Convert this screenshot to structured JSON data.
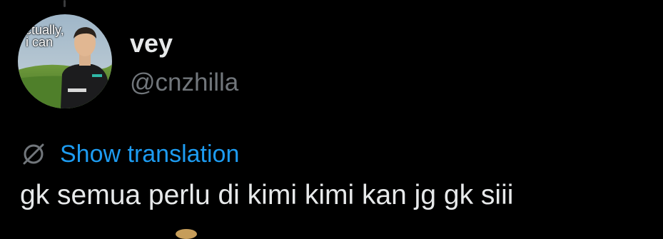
{
  "user": {
    "display_name": "vey",
    "handle": "@cnzhilla",
    "avatar_caption": "actually,\ni can"
  },
  "translation": {
    "label": "Show translation",
    "icon": "globe-off-icon"
  },
  "tweet": {
    "text": "gk semua perlu di kimi kimi kan jg gk siii"
  },
  "colors": {
    "background": "#000000",
    "text_primary": "#e7e9ea",
    "text_secondary": "#71767b",
    "link": "#1d9bf0"
  }
}
